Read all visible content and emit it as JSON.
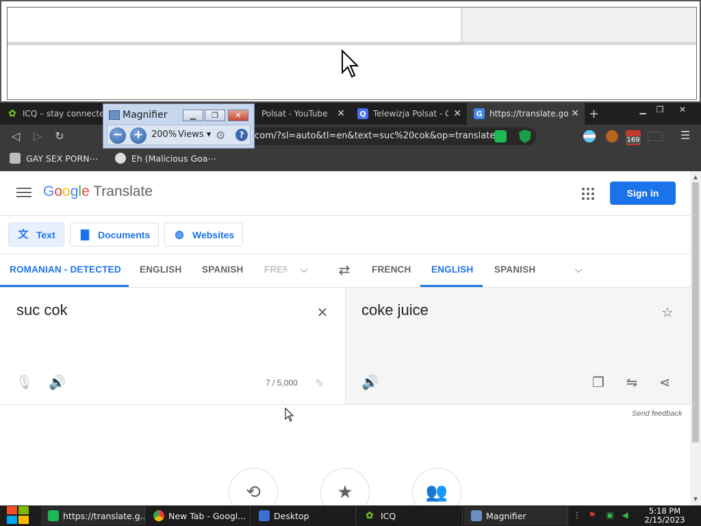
{
  "browser": {
    "tabs": [
      {
        "label": "ICQ – stay connected",
        "active": false
      },
      {
        "label": "Polsat - YouTube",
        "active": false
      },
      {
        "label": "Telewizja Polsat - Google",
        "active": false
      },
      {
        "label": "https://translate.google.com",
        "active": true
      }
    ],
    "new_tab_label": "+",
    "address": "com/?sl=auto&tl=en&text=suc%20cok&op=translate",
    "extension_badge": "169",
    "bookmarks": [
      {
        "label": "GAY SEX PORN⋯"
      },
      {
        "label": "Eh (Malicious Goa⋯"
      }
    ]
  },
  "magnifier": {
    "title": "Magnifier",
    "zoom_level": "200%",
    "views_label": "Views ▾",
    "minus": "−",
    "plus": "+",
    "help": "?"
  },
  "translate": {
    "logo_google": [
      "G",
      "o",
      "o",
      "g",
      "l",
      "e"
    ],
    "logo_product": "Translate",
    "sign_in": "Sign in",
    "modes": [
      {
        "label": "Text",
        "selected": true
      },
      {
        "label": "Documents",
        "selected": false
      },
      {
        "label": "Websites",
        "selected": false
      }
    ],
    "source_langs": [
      "ROMANIAN - DETECTED",
      "ENGLISH",
      "SPANISH",
      "FREN"
    ],
    "target_langs": [
      "FRENCH",
      "ENGLISH",
      "SPANISH"
    ],
    "source_text": "suc cok",
    "target_text": "coke juice",
    "char_count": "7 / 5,000",
    "send_feedback": "Send feedback",
    "colors": {
      "accent": "#1a73e8",
      "text": "#202124",
      "muted": "#5f6368"
    }
  },
  "taskbar": {
    "items": [
      {
        "label": "https://translate.g..."
      },
      {
        "label": "New Tab - Googl..."
      },
      {
        "label": "Desktop"
      },
      {
        "label": "ICQ"
      },
      {
        "label": "Magnifier"
      }
    ],
    "time": "5:18 PM",
    "date": "2/15/2023"
  }
}
